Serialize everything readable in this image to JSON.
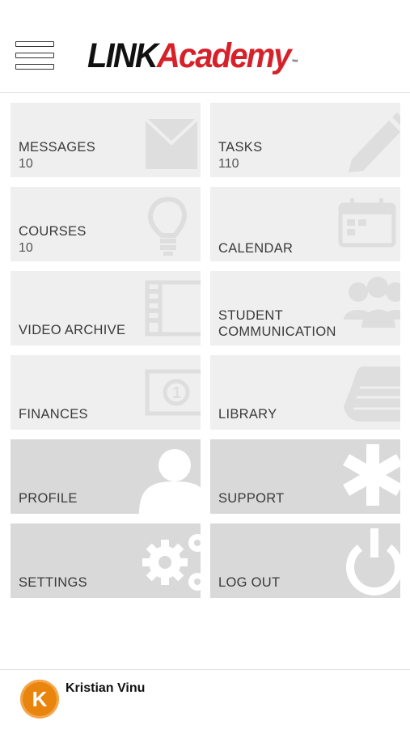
{
  "header": {
    "logo": {
      "part1": "LINK",
      "part2": "Academy",
      "tm": "™"
    },
    "menu_icon": "hamburger-icon"
  },
  "tiles": [
    {
      "label": "MESSAGES",
      "count": "10",
      "icon": "envelope-icon"
    },
    {
      "label": "TASKS",
      "count": "110",
      "icon": "pencil-icon"
    },
    {
      "label": "COURSES",
      "count": "10",
      "icon": "lightbulb-icon"
    },
    {
      "label": "CALENDAR",
      "count": "",
      "icon": "calendar-icon"
    },
    {
      "label": "VIDEO ARCHIVE",
      "count": "",
      "icon": "film-icon"
    },
    {
      "label": "STUDENT\nCOMMUNICATION",
      "count": "",
      "icon": "people-icon"
    },
    {
      "label": "FINANCES",
      "count": "",
      "icon": "banknote-icon"
    },
    {
      "label": "LIBRARY",
      "count": "",
      "icon": "book-icon"
    },
    {
      "label": "PROFILE",
      "count": "",
      "icon": "user-icon"
    },
    {
      "label": "SUPPORT",
      "count": "",
      "icon": "asterisk-icon"
    },
    {
      "label": "SETTINGS",
      "count": "",
      "icon": "gears-icon"
    },
    {
      "label": "LOG OUT",
      "count": "",
      "icon": "power-icon"
    }
  ],
  "footer": {
    "avatar_initial": "K",
    "user_name": "Kristian Vinu"
  },
  "colors": {
    "brand_red": "#d7212a",
    "tile_light": "#efefef",
    "tile_dark": "#d9d9d9",
    "avatar_orange": "#e9840d"
  }
}
